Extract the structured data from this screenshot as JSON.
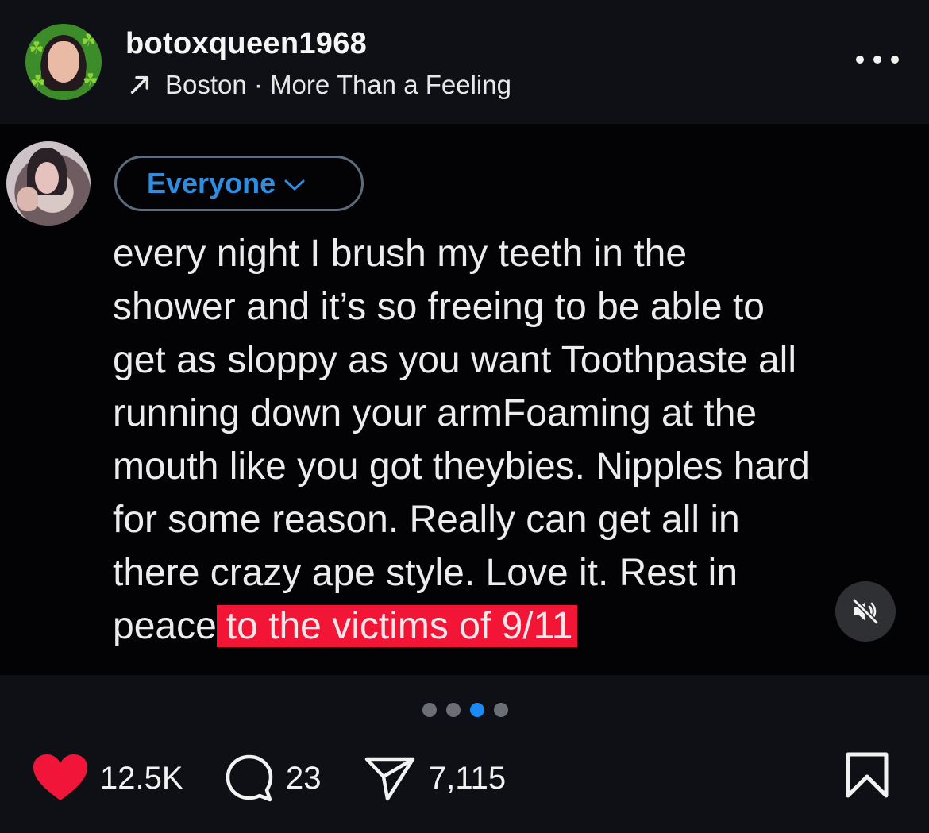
{
  "post": {
    "username": "botoxqueen1968",
    "music": "Boston · More Than a Feeling"
  },
  "tweet": {
    "audience_label": "Everyone",
    "text_main": "every night I brush my teeth in the\nshower and it’s so freeing to be able to\nget as sloppy as you want Toothpaste all\nrunning down your armFoaming at the\nmouth like you got theybies. Nipples hard\nfor some reason. Really can get all in\nthere crazy ape style. Love it. Rest in\npeace",
    "text_highlight": "to the victims of 9/11",
    "highlight_color": "#f21535"
  },
  "carousel": {
    "total": 4,
    "active_index": 2,
    "accent": "#1b8af3"
  },
  "actions": {
    "likes": "12.5K",
    "comments": "23",
    "shares": "7,115",
    "like_color": "#f2153a"
  },
  "icons": {
    "music": "arrow-up-right-icon",
    "more": "more-icon",
    "mute": "speaker-muted-icon",
    "like": "heart-icon",
    "comment": "comment-icon",
    "share": "send-icon",
    "bookmark": "bookmark-icon"
  }
}
